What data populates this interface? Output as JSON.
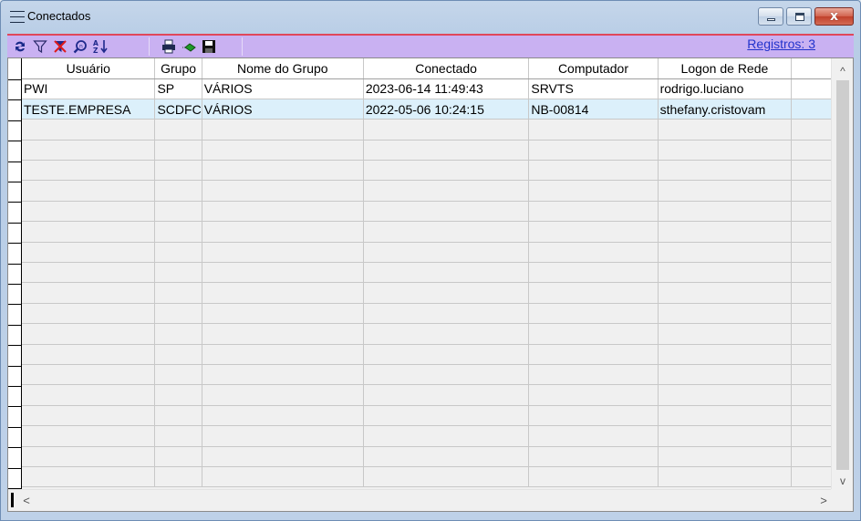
{
  "window": {
    "title": "Conectados",
    "minimize_icon": "minimize-icon",
    "maximize_icon": "maximize-icon",
    "close_glyph": "x"
  },
  "toolbar": {
    "registros_label": "Registros: 3",
    "buttons": [
      {
        "name": "refresh-icon"
      },
      {
        "name": "filter-icon"
      },
      {
        "name": "clear-filter-icon"
      },
      {
        "name": "search-icon"
      },
      {
        "name": "sort-icon"
      },
      {
        "name": "print-icon"
      },
      {
        "name": "export-icon"
      },
      {
        "name": "save-icon"
      }
    ]
  },
  "grid": {
    "columns": [
      "Usuário",
      "Grupo",
      "Nome do Grupo",
      "Conectado",
      "Computador",
      "Logon de Rede"
    ],
    "rows": [
      [
        "PWI",
        "SP",
        "VÁRIOS",
        "2023-06-14 11:49:43",
        "SRVTS",
        "rodrigo.luciano"
      ],
      [
        "TESTE.EMPRESA",
        "SCDFC",
        "VÁRIOS",
        "2022-05-06 10:24:15",
        "NB-00814",
        "sthefany.cristovam"
      ]
    ]
  },
  "scrollbars": {
    "up": "^",
    "down": "v",
    "left": "<",
    "right": ">"
  }
}
